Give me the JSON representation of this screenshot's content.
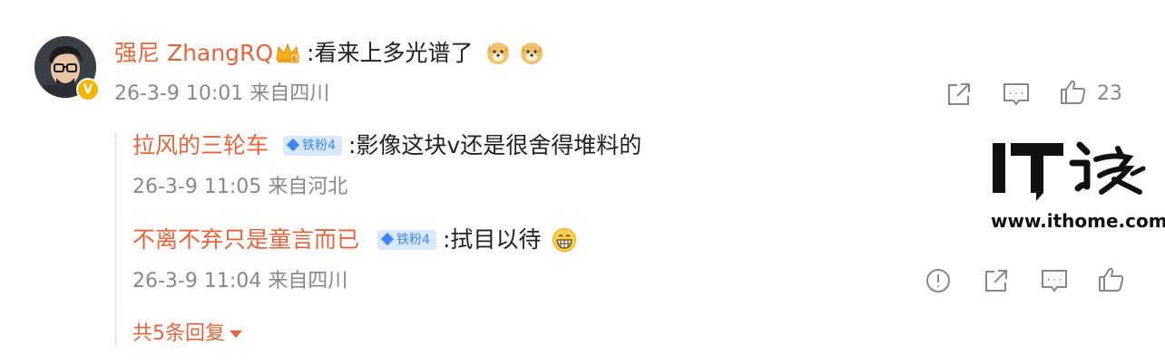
{
  "main_comment": {
    "author": "强尼 ZhangRQ",
    "content": ":看来上多光谱了",
    "emojis": [
      "doge-emoji",
      "doge-emoji"
    ],
    "time": "26-3-9 10:01",
    "location": "来自四川",
    "like_count": "23"
  },
  "replies": [
    {
      "author": "拉风的三轮车",
      "badge": "铁粉4",
      "content": ":影像这块v还是很舍得堆料的",
      "time": "26-3-9 11:05",
      "location": "来自河北"
    },
    {
      "author": "不离不弃只是童言而已",
      "badge": "铁粉4",
      "content": ":拭目以待",
      "emoji": "grin-emoji",
      "time": "26-3-9 11:04",
      "location": "来自四川"
    }
  ],
  "more_replies": "共5条回复",
  "watermark": {
    "logo": "IT之家",
    "url": "www.ithome.com"
  },
  "colors": {
    "name": "#e8633a",
    "meta": "#888888",
    "badge_bg": "#d8e8ff",
    "badge_text": "#3f86f5",
    "icon": "#888888"
  }
}
